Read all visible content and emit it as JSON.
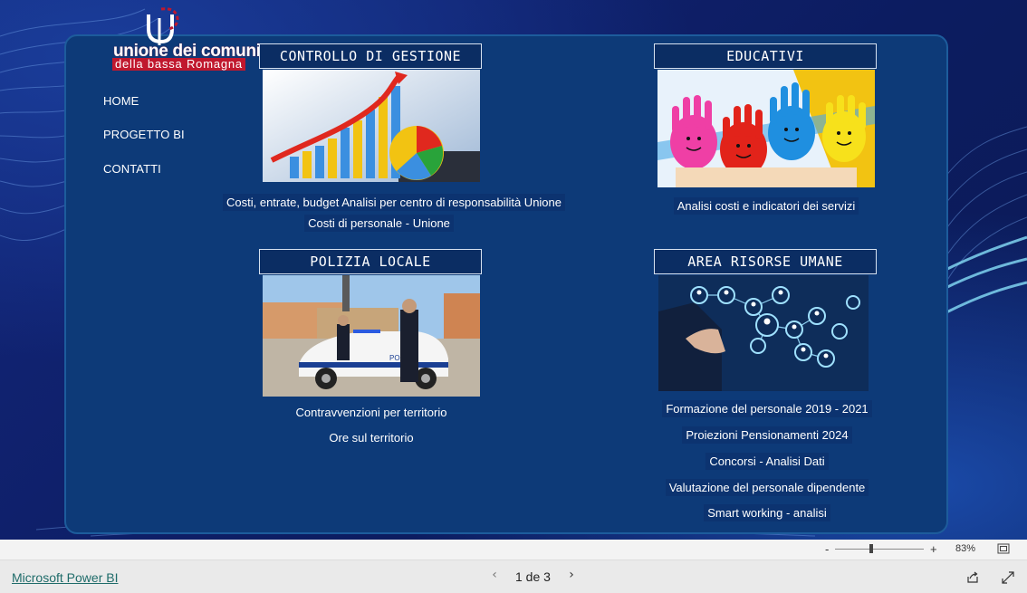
{
  "logo": {
    "line1": "unione dei comuni",
    "line2": "della bassa Romagna"
  },
  "nav": [
    {
      "label": "HOME"
    },
    {
      "label": "PROGETTO BI"
    },
    {
      "label": "CONTATTI"
    }
  ],
  "tiles": {
    "controllo": {
      "title": "CONTROLLO DI GESTIONE",
      "links": [
        "Costi, entrate, budget Analisi per centro di responsabilità Unione",
        "Costi di personale - Unione"
      ]
    },
    "educativi": {
      "title": "EDUCATIVI",
      "links": [
        "Analisi costi e indicatori dei servizi"
      ]
    },
    "polizia": {
      "title": "POLIZIA LOCALE",
      "car_text": "POLIZIA",
      "links": [
        "Contravvenzioni per territorio",
        "Ore sul territorio"
      ]
    },
    "risorse": {
      "title": "AREA RISORSE UMANE",
      "links": [
        "Formazione del personale 2019 - 2021",
        "Proiezioni Pensionamenti 2024",
        "Concorsi - Analisi Dati",
        "Valutazione del personale dipendente",
        "Smart working - analisi"
      ]
    }
  },
  "zoom": {
    "minus": "-",
    "plus": "+",
    "level": "83%",
    "percent": 83
  },
  "footer": {
    "brand": "Microsoft Power BI",
    "page": "1 de 3"
  },
  "colors": {
    "panel": "#0d3a78",
    "logo_red": "#c0182e",
    "brand_link": "#1f6c6a"
  }
}
